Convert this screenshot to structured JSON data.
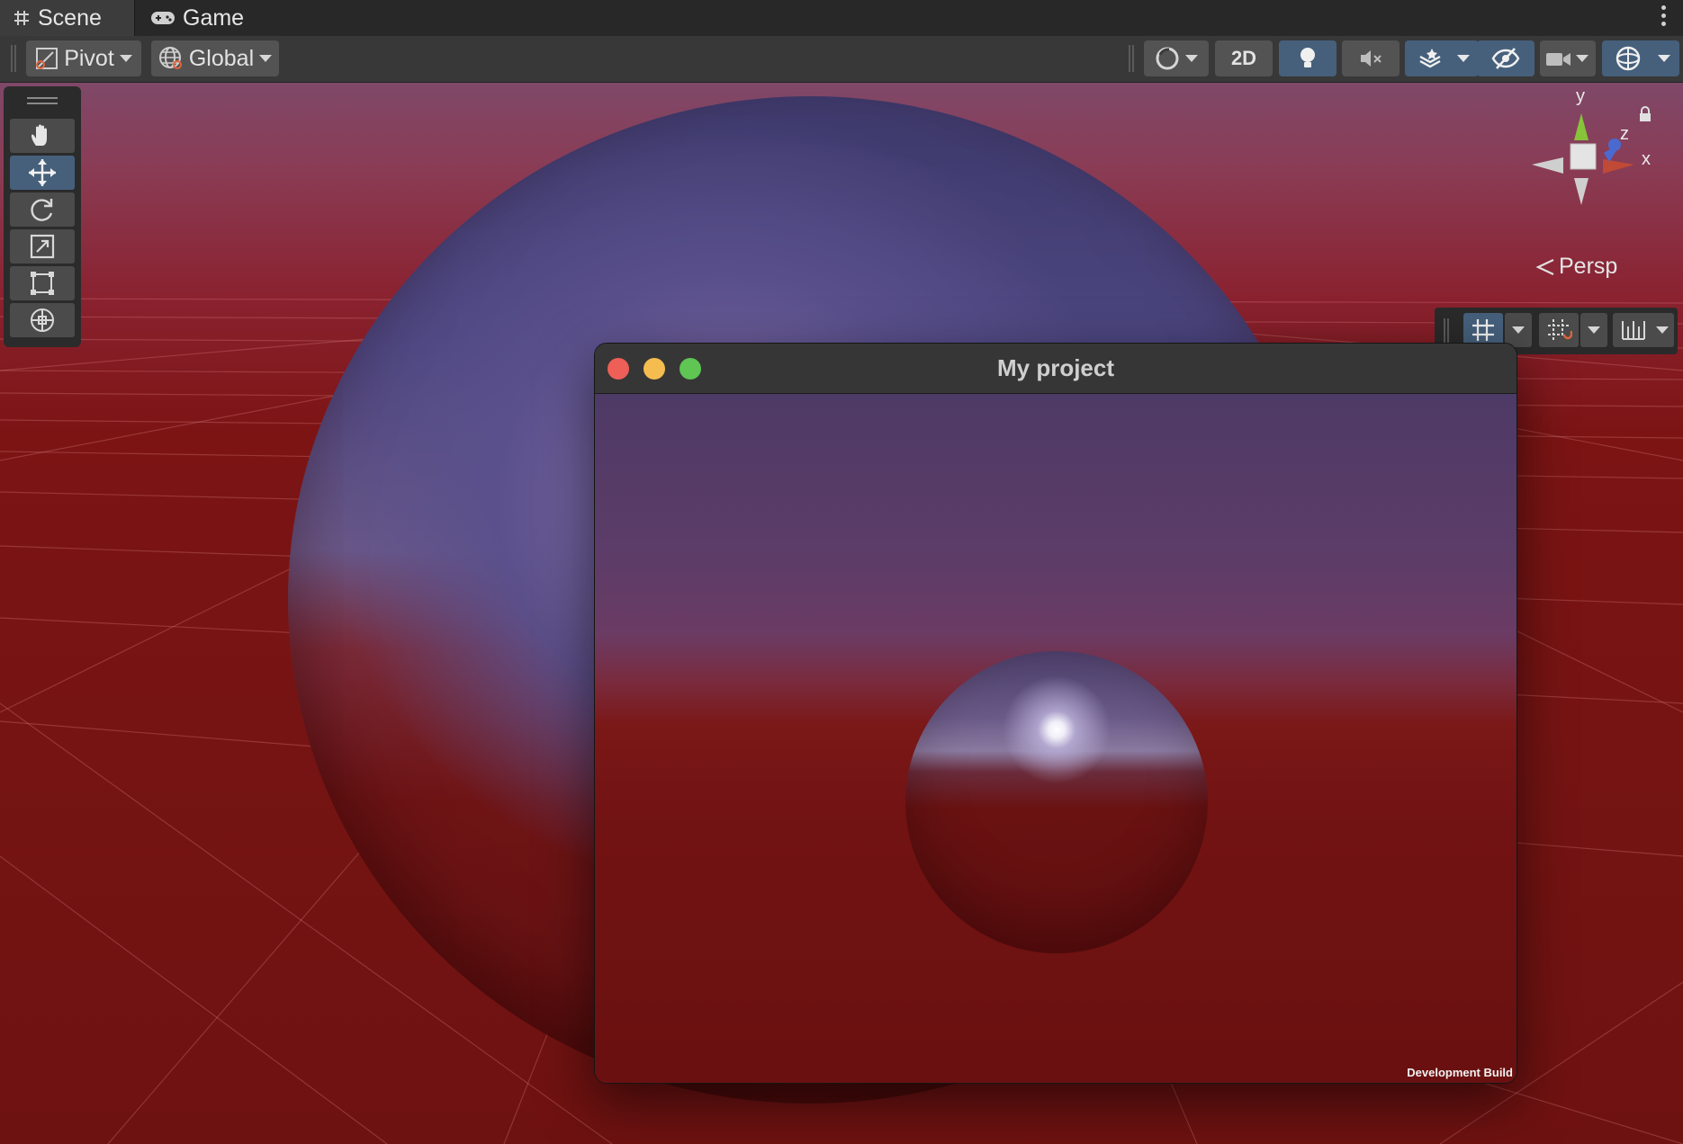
{
  "tabs": [
    {
      "label": "Scene",
      "icon": "grid-hash-icon",
      "active": true
    },
    {
      "label": "Game",
      "icon": "gamepad-icon",
      "active": false
    }
  ],
  "toolbar": {
    "pivot_label": "Pivot",
    "global_label": "Global",
    "mode_2d_label": "2D"
  },
  "tools": [
    "hand-tool",
    "move-tool",
    "rotate-tool",
    "scale-tool",
    "rect-tool",
    "transform-tool"
  ],
  "gizmo": {
    "axis_y": "y",
    "axis_z": "z",
    "axis_x": "x",
    "projection_label": "Persp"
  },
  "game_window": {
    "title": "My project",
    "watermark": "Development Build"
  },
  "colors": {
    "accent": "#46607c",
    "close": "#ee5f57",
    "minimize": "#f5bd4f",
    "maximize": "#5fc553"
  }
}
